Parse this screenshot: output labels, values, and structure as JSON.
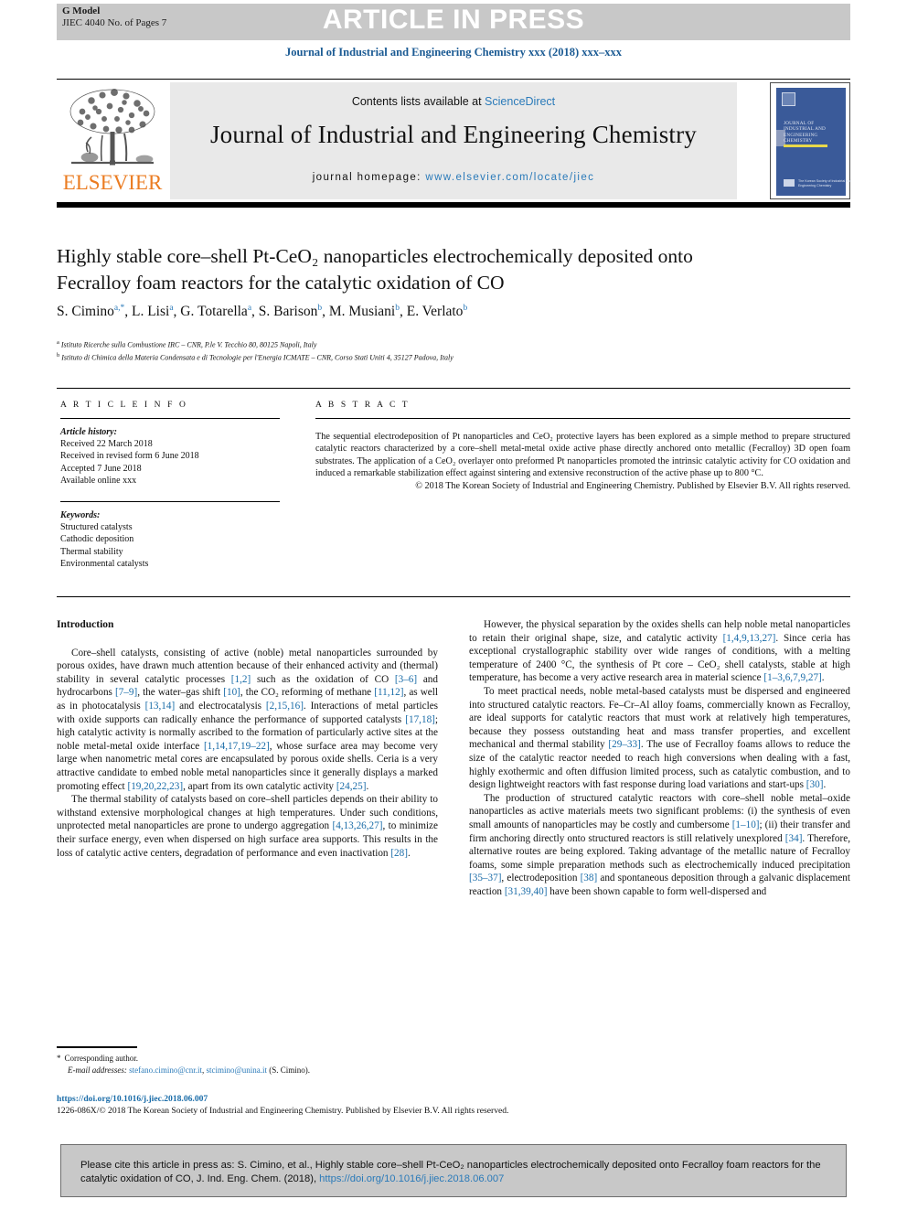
{
  "banner": {
    "gmodel_line1": "G Model",
    "gmodel_line2": "JIEC 4040 No. of Pages 7",
    "article_in_press": "ARTICLE IN PRESS"
  },
  "running_head": "Journal of Industrial and Engineering Chemistry xxx (2018) xxx–xxx",
  "masthead": {
    "contents_prefix": "Contents lists available at ",
    "sciencedirect": "ScienceDirect",
    "journal_title": "Journal of Industrial and Engineering Chemistry",
    "homepage_prefix": "journal homepage: ",
    "homepage_url": "www.elsevier.com/locate/jiec",
    "publisher_wordmark": "ELSEVIER",
    "cover_title": "JOURNAL OF INDUSTRIAL AND ENGINEERING CHEMISTRY",
    "cover_footer": "The Korean Society of Industrial and Engineering Chemistry"
  },
  "article": {
    "title": "Highly stable core–shell Pt-CeO₂ nanoparticles electrochemically deposited onto Fecralloy foam reactors for the catalytic oxidation of CO",
    "authors_html": "S. Cimino<sup>a,</sup><sup>*</sup>, L. Lisi<sup>a</sup>, G. Totarella<sup>a</sup>, S. Barison<sup>b</sup>, M. Musiani<sup>b</sup>, E. Verlato<sup>b</sup>",
    "affiliation_a": "Istituto Ricerche sulla Combustione IRC – CNR, P.le V. Tecchio 80, 80125 Napoli, Italy",
    "affiliation_b": "Istituto di Chimica della Materia Condensata e di Tecnologie per l'Energia ICMATE – CNR, Corso Stati Uniti 4, 35127 Padova, Italy"
  },
  "article_info": {
    "heading": "A R T I C L E   I N F O",
    "history_label": "Article history:",
    "history": [
      "Received 22 March 2018",
      "Received in revised form 6 June 2018",
      "Accepted 7 June 2018",
      "Available online xxx"
    ],
    "keywords_label": "Keywords:",
    "keywords": [
      "Structured catalysts",
      "Cathodic deposition",
      "Thermal stability",
      "Environmental catalysts"
    ]
  },
  "abstract": {
    "heading": "A B S T R A C T",
    "body": "The sequential electrodeposition of Pt nanoparticles and CeO₂ protective layers has been explored as a simple method to prepare structured catalytic reactors characterized by a core–shell metal-metal oxide active phase directly anchored onto metallic (Fecralloy) 3D open foam substrates. The application of a CeO₂ overlayer onto preformed Pt nanoparticles promoted the intrinsic catalytic activity for CO oxidation and induced a remarkable stabilization effect against sintering and extensive reconstruction of the active phase up to 800 °C.",
    "copyright": "© 2018 The Korean Society of Industrial and Engineering Chemistry. Published by Elsevier B.V. All rights reserved."
  },
  "body": {
    "intro_heading": "Introduction",
    "left_paragraphs": [
      "Core–shell catalysts, consisting of active (noble) metal nanoparticles surrounded by porous oxides, have drawn much attention because of their enhanced activity and (thermal) stability in several catalytic processes [1,2] such as the oxidation of CO [3–6] and hydrocarbons [7–9], the water–gas shift [10], the CO₂ reforming of methane [11,12], as well as in photocatalysis [13,14] and electrocatalysis [2,15,16]. Interactions of metal particles with oxide supports can radically enhance the performance of supported catalysts [17,18]; high catalytic activity is normally ascribed to the formation of particularly active sites at the noble metal-metal oxide interface [1,14,17,19–22], whose surface area may become very large when nanometric metal cores are encapsulated by porous oxide shells. Ceria is a very attractive candidate to embed noble metal nanoparticles since it generally displays a marked promoting effect [19,20,22,23], apart from its own catalytic activity [24,25].",
      "The thermal stability of catalysts based on core–shell particles depends on their ability to withstand extensive morphological changes at high temperatures. Under such conditions, unprotected metal nanoparticles are prone to undergo aggregation [4,13,26,27], to minimize their surface energy, even when dispersed on high surface area supports. This results in the loss of catalytic active centers, degradation of performance and even inactivation [28]."
    ],
    "right_paragraphs": [
      "However, the physical separation by the oxides shells can help noble metal nanoparticles to retain their original shape, size, and catalytic activity [1,4,9,13,27]. Since ceria has exceptional crystallographic stability over wide ranges of conditions, with a melting temperature of 2400 °C, the synthesis of Pt core – CeO₂ shell catalysts, stable at high temperature, has become a very active research area in material science [1–3,6,7,9,27].",
      "To meet practical needs, noble metal-based catalysts must be dispersed and engineered into structured catalytic reactors. Fe–Cr–Al alloy foams, commercially known as Fecralloy, are ideal supports for catalytic reactors that must work at relatively high temperatures, because they possess outstanding heat and mass transfer properties, and excellent mechanical and thermal stability [29–33]. The use of Fecralloy foams allows to reduce the size of the catalytic reactor needed to reach high conversions when dealing with a fast, highly exothermic and often diffusion limited process, such as catalytic combustion, and to design lightweight reactors with fast response during load variations and start-ups [30].",
      "The production of structured catalytic reactors with core–shell noble metal–oxide nanoparticles as active materials meets two significant problems: (i) the synthesis of even small amounts of nanoparticles may be costly and cumbersome [1–10]; (ii) their transfer and firm anchoring directly onto structured reactors is still relatively unexplored [34]. Therefore, alternative routes are being explored. Taking advantage of the metallic nature of Fecralloy foams, some simple preparation methods such as electrochemically induced precipitation [35–37], electrodeposition [38] and spontaneous deposition through a galvanic displacement reaction [31,39,40] have been shown capable to form well-dispersed and"
    ]
  },
  "footnote": {
    "corresponding": "Corresponding author.",
    "email_label": "E-mail addresses:",
    "email1": "stefano.cimino@cnr.it",
    "email2": "stcimino@unina.it",
    "email_suffix": "(S. Cimino)."
  },
  "bottom_meta": {
    "doi": "https://doi.org/10.1016/j.jiec.2018.06.007",
    "issn_line": "1226-086X/© 2018 The Korean Society of Industrial and Engineering Chemistry. Published by Elsevier B.V. All rights reserved."
  },
  "cite_box": {
    "text_before_doi": "Please cite this article in press as: S. Cimino, et al., Highly stable core–shell Pt-CeO₂ nanoparticles electrochemically deposited onto Fecralloy foam reactors for the catalytic oxidation of CO, J. Ind. Eng. Chem. (2018), ",
    "doi": "https://doi.org/10.1016/j.jiec.2018.06.007"
  },
  "colors": {
    "link_blue": "#2a7ab9",
    "ref_blue": "#1a6ca8",
    "elsevier_orange": "#eb7c22",
    "banner_grey": "#c8c8c8",
    "masthead_grey": "#e9e9e9",
    "cover_blue": "#3a5a99"
  }
}
